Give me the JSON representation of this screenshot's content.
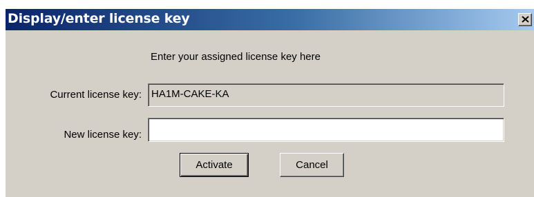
{
  "dialog": {
    "title": "Display/enter license key",
    "close_glyph": "×",
    "instruction": "Enter your assigned license key here",
    "current_label": "Current license key:",
    "current_value": "HA1M-CAKE-KA",
    "new_label": "New license key:",
    "new_value": "",
    "new_placeholder": "",
    "activate_label": "Activate",
    "cancel_label": "Cancel",
    "colors": {
      "title_bar_start": "#0a246a",
      "title_bar_end": "#a6caf0",
      "face": "#d4d0c8"
    },
    "icons": {
      "close": "close-icon"
    }
  }
}
